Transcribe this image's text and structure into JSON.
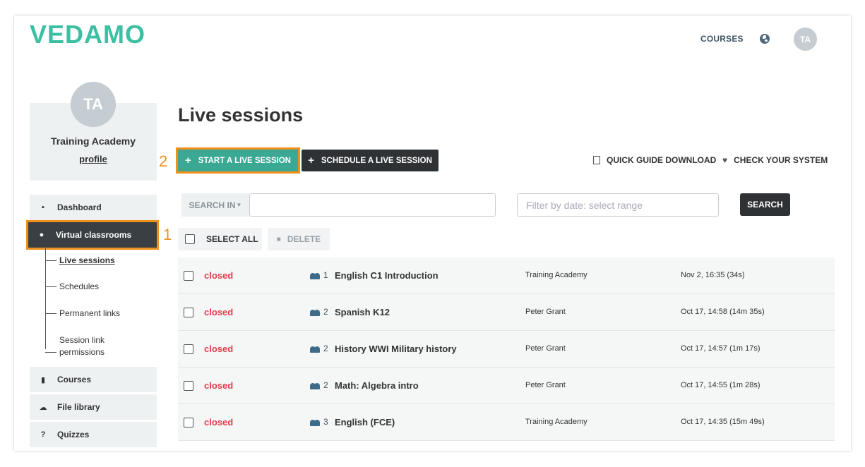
{
  "header": {
    "logo": "VEDAMO",
    "nav_courses": "COURSES",
    "avatar_initials": "TA"
  },
  "sidebar": {
    "avatar_initials": "TA",
    "org_name": "Training Academy",
    "profile_link": "profile",
    "items": [
      {
        "label": "Dashboard",
        "icon": "grid-icon"
      },
      {
        "label": "Virtual classrooms",
        "icon": "play-circle-icon"
      },
      {
        "label": "Courses",
        "icon": "book-icon"
      },
      {
        "label": "File library",
        "icon": "cloud-upload-icon"
      },
      {
        "label": "Quizzes",
        "icon": "question-circle-icon"
      }
    ],
    "subitems": [
      "Live sessions",
      "Schedules",
      "Permanent links",
      "Session link permissions"
    ],
    "callout_1": "1",
    "callout_2": "2"
  },
  "main": {
    "title": "Live sessions",
    "start_button": "START A LIVE SESSION",
    "schedule_button": "SCHEDULE A LIVE SESSION",
    "quick_guide": "QUICK GUIDE DOWNLOAD",
    "check_system": "CHECK YOUR SYSTEM",
    "search_in": "SEARCH IN",
    "search_value": "",
    "date_placeholder": "Filter by date: select range",
    "search_button": "SEARCH",
    "select_all": "SELECT ALL",
    "delete": "DELETE"
  },
  "sessions": [
    {
      "status": "closed",
      "participants": "1",
      "name": "English C1 Introduction",
      "owner": "Training Academy",
      "date": "Nov 2, 16:35 (34s)"
    },
    {
      "status": "closed",
      "participants": "2",
      "name": "Spanish K12",
      "owner": "Peter Grant",
      "date": "Oct 17, 14:58 (14m 35s)"
    },
    {
      "status": "closed",
      "participants": "2",
      "name": "History WWI Military history",
      "owner": "Peter Grant",
      "date": "Oct 17, 14:57 (1m 17s)"
    },
    {
      "status": "closed",
      "participants": "2",
      "name": "Math: Algebra intro",
      "owner": "Peter Grant",
      "date": "Oct 17, 14:55 (1m 28s)"
    },
    {
      "status": "closed",
      "participants": "3",
      "name": "English (FCE)",
      "owner": "Training Academy",
      "date": "Oct 17, 14:35 (15m 49s)"
    }
  ],
  "colors": {
    "brand": "#3cbfa3",
    "start_button": "#3aa893",
    "highlight": "#f0901c",
    "status_closed": "#e23d4c",
    "dark_button": "#2f3235"
  }
}
